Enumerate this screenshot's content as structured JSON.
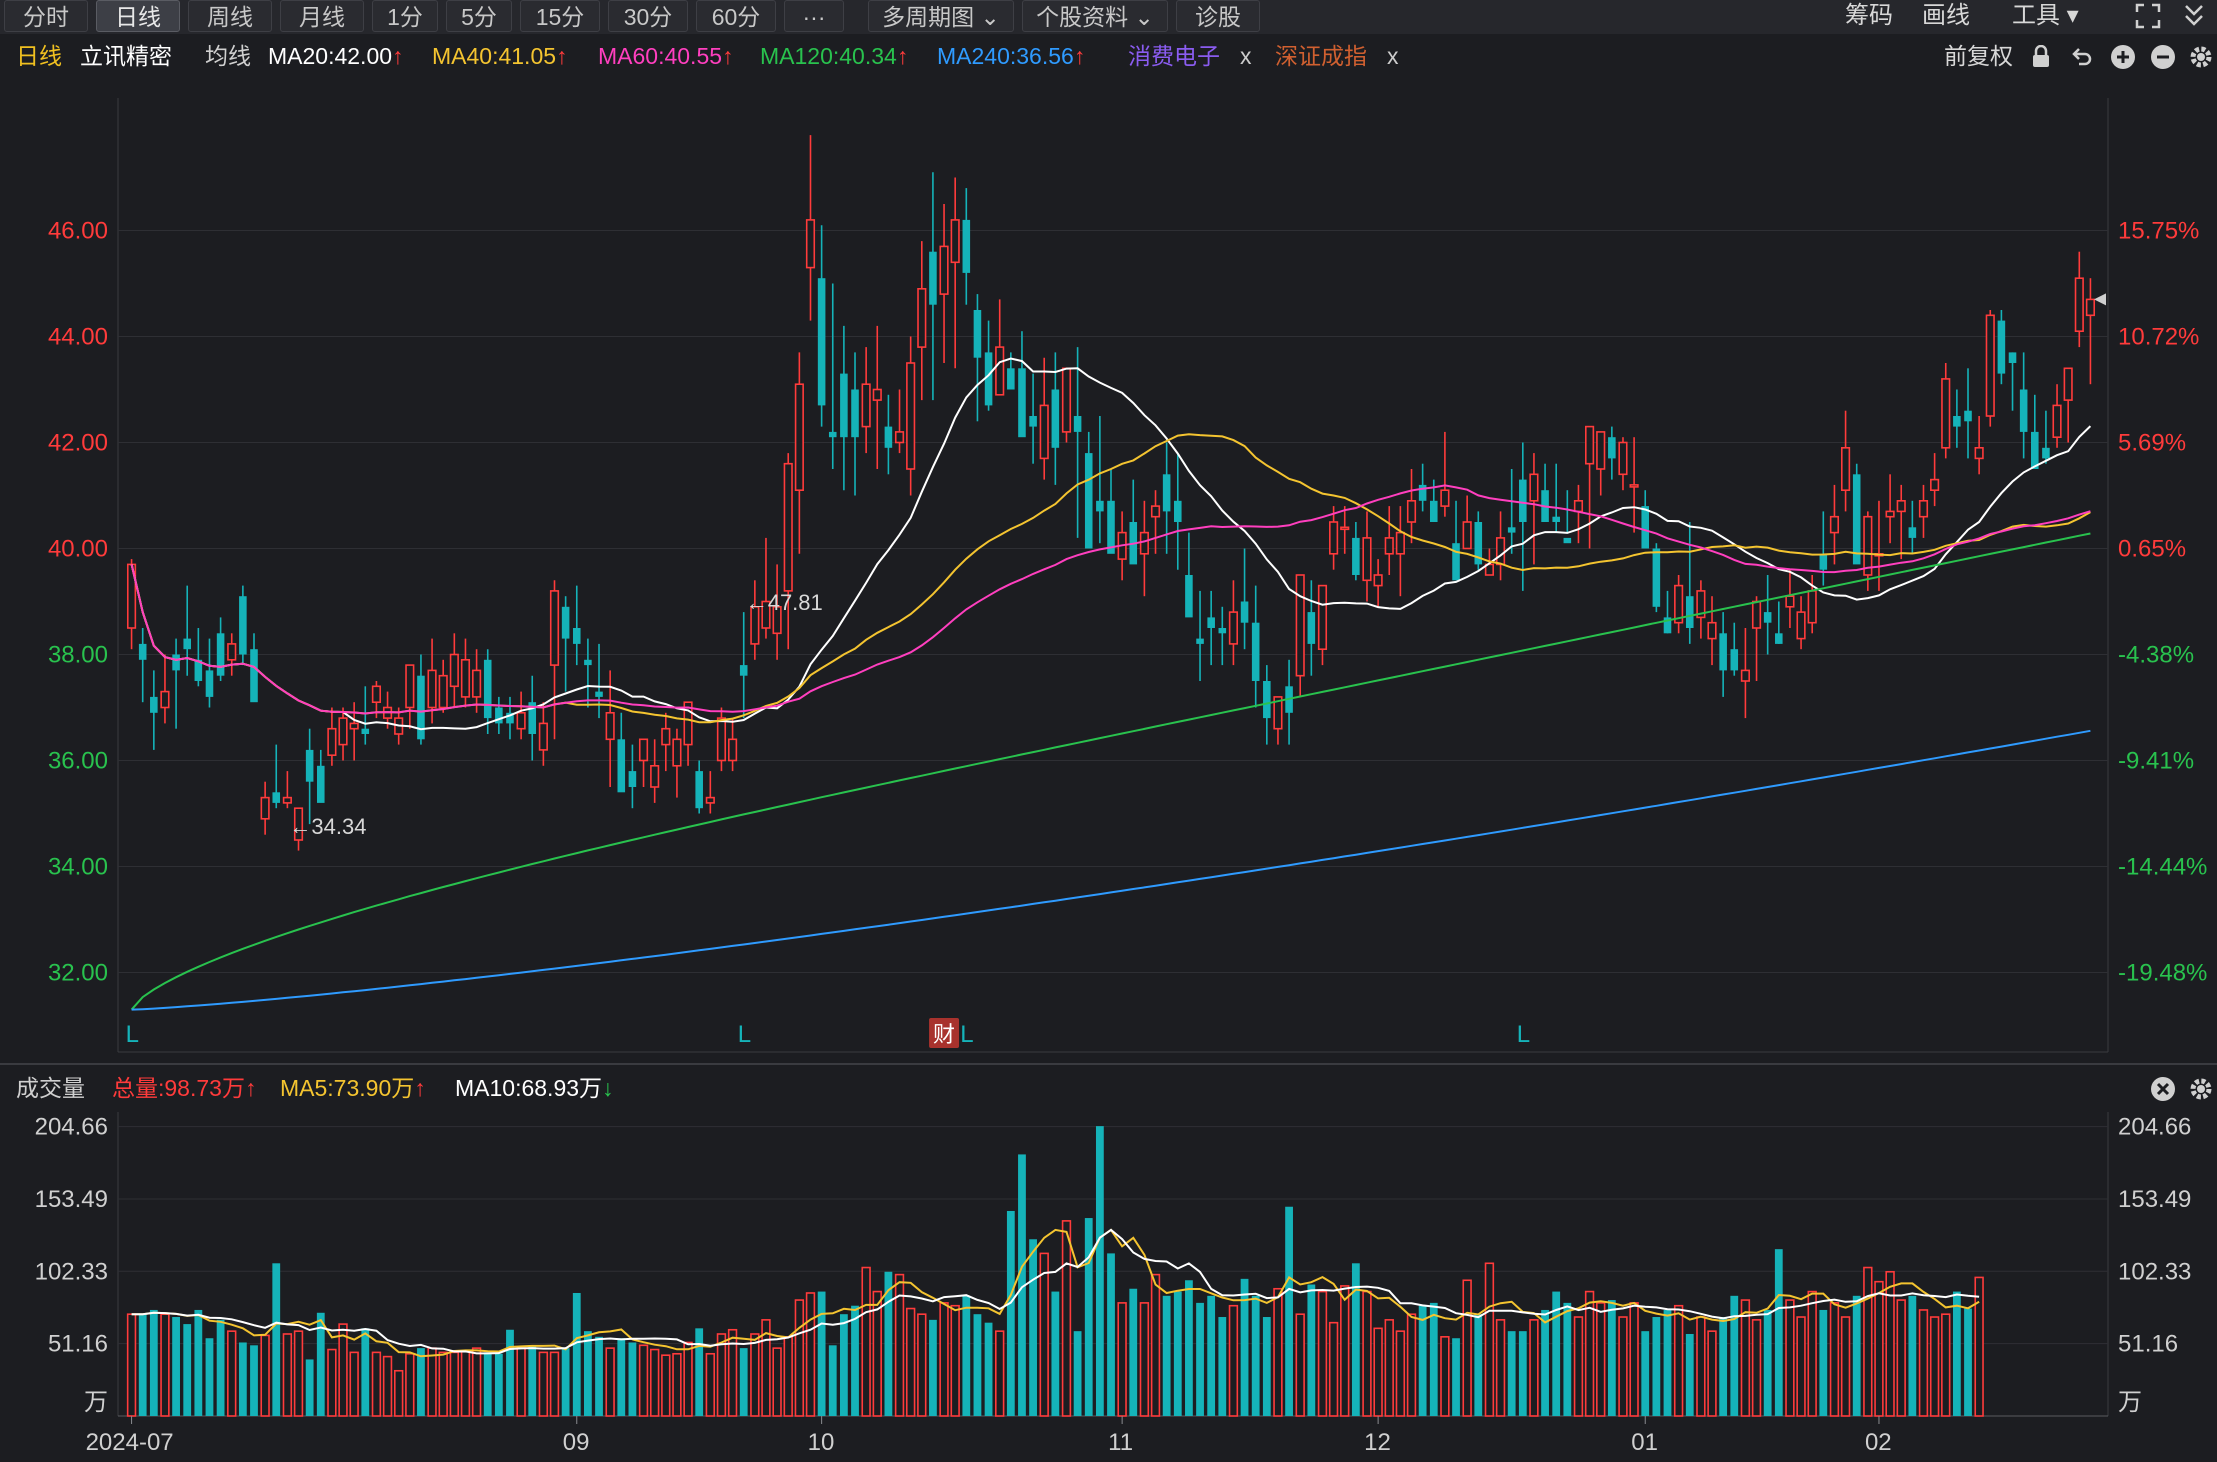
{
  "toolbar": {
    "tabs": [
      "分时",
      "日线",
      "周线",
      "月线",
      "1分",
      "5分",
      "15分",
      "30分",
      "60分",
      "···",
      "多周期图",
      "个股资料",
      "诊股"
    ],
    "active_tab": "日线",
    "right_items": [
      "筹码",
      "画线",
      "工具"
    ]
  },
  "info": {
    "period": "日线",
    "stock_name": "立讯精密",
    "ma_label": "均线",
    "ma": [
      {
        "text": "MA20:42.00",
        "arrow": "↑",
        "color": "#ffffff"
      },
      {
        "text": "MA40:41.05",
        "arrow": "↑",
        "color": "#f4c430"
      },
      {
        "text": "MA60:40.55",
        "arrow": "↑",
        "color": "#ff3fbf"
      },
      {
        "text": "MA120:40.34",
        "arrow": "↑",
        "color": "#29c24e"
      },
      {
        "text": "MA240:36.56",
        "arrow": "↑",
        "color": "#2f9bff"
      }
    ],
    "overlay1": "消费电子",
    "overlay2": "深证成指",
    "close_x": "x",
    "adjust": "前复权"
  },
  "volume_info": {
    "label": "成交量",
    "total": "总量:98.73万",
    "total_arrow": "↑",
    "ma5": "MA5:73.90万",
    "ma5_arrow": "↑",
    "ma10": "MA10:68.93万",
    "ma10_arrow": "↓"
  },
  "colors": {
    "up": "#ff3b3b",
    "down": "#15b3b9",
    "ma20": "#ffffff",
    "ma40": "#f4c430",
    "ma60": "#ff3fbf",
    "ma120": "#29c24e",
    "ma240": "#2f9bff"
  },
  "chart_data": {
    "type": "candlestick",
    "price_axis": {
      "ylim": [
        30.5,
        48.5
      ],
      "ticks": [
        "46.00",
        "44.00",
        "42.00",
        "40.00",
        "38.00",
        "36.00",
        "34.00",
        "32.00"
      ],
      "tick_values": [
        46,
        44,
        42,
        40,
        38,
        36,
        34,
        32
      ]
    },
    "pct_axis": {
      "ticks": [
        "15.75%",
        "10.72%",
        "5.69%",
        "0.65%",
        "-4.38%",
        "-9.41%",
        "-14.44%",
        "-19.48%"
      ]
    },
    "x_labels": [
      "2024-07",
      "09",
      "10",
      "11",
      "12",
      "01",
      "02"
    ],
    "x_label_index": [
      0,
      40,
      62,
      89,
      112,
      136,
      157
    ],
    "annotations": {
      "high": "←47.81",
      "high_index": 55,
      "low": "←34.34",
      "low_index": 14
    },
    "markers": {
      "L_indices": [
        0,
        55,
        75,
        125
      ],
      "L_text": "L",
      "cai_index": 73,
      "cai_text": "财"
    },
    "ohlc": [
      [
        38.5,
        39.8,
        38.1,
        39.7
      ],
      [
        38.2,
        38.5,
        37.1,
        37.9
      ],
      [
        37.2,
        37.7,
        36.2,
        36.9
      ],
      [
        37.0,
        38.0,
        36.7,
        37.3
      ],
      [
        38.0,
        38.3,
        36.6,
        37.7
      ],
      [
        38.3,
        39.3,
        37.6,
        38.1
      ],
      [
        37.9,
        38.5,
        37.4,
        37.5
      ],
      [
        37.7,
        38.3,
        37.0,
        37.2
      ],
      [
        38.4,
        38.7,
        37.5,
        37.6
      ],
      [
        37.9,
        38.4,
        37.6,
        38.2
      ],
      [
        39.1,
        39.3,
        37.8,
        38.0
      ],
      [
        38.1,
        38.4,
        37.9,
        37.1
      ],
      [
        34.9,
        35.6,
        34.6,
        35.3
      ],
      [
        35.4,
        36.3,
        35.1,
        35.2
      ],
      [
        35.2,
        35.8,
        35.1,
        35.3
      ],
      [
        34.5,
        35.1,
        34.3,
        35.1
      ],
      [
        36.2,
        36.6,
        34.8,
        35.6
      ],
      [
        35.9,
        36.2,
        35.3,
        35.2
      ],
      [
        36.1,
        37.0,
        35.9,
        36.6
      ],
      [
        36.3,
        37.0,
        36.0,
        36.8
      ],
      [
        36.6,
        37.1,
        36.0,
        36.7
      ],
      [
        36.6,
        37.4,
        36.3,
        36.5
      ],
      [
        37.1,
        37.5,
        36.8,
        37.4
      ],
      [
        36.8,
        37.3,
        36.6,
        37.0
      ],
      [
        36.5,
        37.0,
        36.3,
        36.8
      ],
      [
        37.0,
        37.8,
        36.6,
        37.8
      ],
      [
        37.6,
        38.0,
        36.3,
        36.4
      ],
      [
        37.0,
        38.3,
        36.7,
        37.7
      ],
      [
        37.0,
        37.9,
        36.9,
        37.6
      ],
      [
        37.4,
        38.4,
        37.0,
        38.0
      ],
      [
        37.2,
        38.3,
        37.0,
        37.9
      ],
      [
        37.2,
        38.1,
        36.9,
        37.7
      ],
      [
        37.9,
        38.1,
        36.5,
        36.8
      ],
      [
        37.0,
        37.2,
        36.5,
        36.7
      ],
      [
        36.9,
        37.2,
        36.4,
        36.7
      ],
      [
        36.6,
        37.3,
        36.4,
        36.9
      ],
      [
        37.1,
        37.6,
        36.0,
        36.5
      ],
      [
        36.2,
        37.1,
        35.9,
        36.7
      ],
      [
        37.8,
        39.4,
        36.4,
        39.2
      ],
      [
        38.9,
        39.1,
        37.3,
        38.3
      ],
      [
        38.5,
        39.3,
        37.8,
        38.2
      ],
      [
        37.9,
        38.3,
        37.0,
        37.8
      ],
      [
        37.3,
        38.2,
        36.8,
        37.2
      ],
      [
        36.4,
        37.7,
        35.5,
        36.9
      ],
      [
        36.4,
        36.9,
        35.6,
        35.4
      ],
      [
        35.8,
        36.3,
        35.1,
        35.5
      ],
      [
        36.0,
        36.3,
        35.5,
        36.4
      ],
      [
        35.5,
        36.4,
        35.2,
        35.9
      ],
      [
        36.3,
        36.9,
        35.8,
        36.6
      ],
      [
        35.9,
        36.6,
        35.3,
        36.4
      ],
      [
        36.3,
        36.9,
        35.9,
        37.1
      ],
      [
        35.8,
        36.0,
        35.0,
        35.1
      ],
      [
        35.2,
        35.8,
        35.0,
        35.3
      ],
      [
        36.0,
        37.0,
        35.8,
        36.8
      ],
      [
        36.0,
        36.8,
        35.8,
        36.4
      ],
      [
        37.8,
        38.8,
        36.8,
        37.6
      ],
      [
        38.2,
        39.4,
        37.9,
        38.9
      ],
      [
        38.5,
        40.2,
        38.3,
        39.0
      ],
      [
        38.4,
        39.7,
        37.9,
        38.9
      ],
      [
        39.2,
        41.8,
        38.1,
        41.6
      ],
      [
        41.1,
        43.7,
        39.9,
        43.1
      ],
      [
        45.3,
        47.8,
        44.3,
        46.2
      ],
      [
        45.1,
        46.1,
        42.3,
        42.7
      ],
      [
        42.2,
        45.0,
        41.5,
        42.1
      ],
      [
        43.3,
        44.2,
        41.1,
        42.1
      ],
      [
        43.0,
        43.7,
        41.0,
        42.1
      ],
      [
        42.3,
        43.8,
        41.8,
        43.1
      ],
      [
        42.8,
        44.2,
        41.5,
        43.0
      ],
      [
        42.3,
        42.9,
        41.4,
        41.9
      ],
      [
        42.0,
        43.0,
        41.8,
        42.2
      ],
      [
        41.5,
        44.0,
        41.0,
        43.5
      ],
      [
        43.8,
        45.8,
        42.8,
        44.9
      ],
      [
        45.6,
        47.1,
        42.8,
        44.6
      ],
      [
        44.8,
        46.5,
        43.5,
        45.7
      ],
      [
        45.4,
        47.0,
        43.4,
        46.2
      ],
      [
        46.2,
        46.8,
        44.6,
        45.2
      ],
      [
        44.5,
        44.8,
        42.4,
        43.6
      ],
      [
        43.7,
        44.3,
        42.6,
        42.7
      ],
      [
        42.9,
        44.7,
        42.9,
        43.8
      ],
      [
        43.4,
        43.7,
        43.0,
        43.0
      ],
      [
        43.4,
        44.1,
        42.3,
        42.1
      ],
      [
        42.5,
        43.3,
        41.6,
        42.3
      ],
      [
        41.7,
        43.6,
        41.3,
        42.7
      ],
      [
        43.0,
        43.7,
        41.2,
        41.9
      ],
      [
        42.2,
        43.1,
        42.0,
        43.4
      ],
      [
        42.5,
        43.8,
        40.2,
        42.2
      ],
      [
        41.8,
        42.2,
        41.5,
        40.0
      ],
      [
        40.9,
        42.5,
        40.1,
        40.7
      ],
      [
        40.9,
        41.5,
        40.4,
        39.9
      ],
      [
        39.8,
        40.7,
        39.4,
        40.3
      ],
      [
        40.5,
        41.3,
        39.8,
        39.7
      ],
      [
        39.9,
        40.9,
        39.1,
        40.3
      ],
      [
        40.6,
        41.1,
        39.9,
        40.8
      ],
      [
        41.4,
        42.0,
        39.9,
        40.7
      ],
      [
        40.9,
        41.8,
        39.6,
        40.5
      ],
      [
        39.5,
        40.3,
        38.8,
        38.7
      ],
      [
        38.3,
        39.2,
        37.5,
        38.2
      ],
      [
        38.7,
        39.2,
        37.8,
        38.5
      ],
      [
        38.5,
        38.9,
        37.8,
        38.4
      ],
      [
        38.2,
        39.4,
        37.8,
        38.8
      ],
      [
        39.0,
        40.0,
        38.1,
        38.6
      ],
      [
        38.6,
        39.3,
        37.0,
        37.5
      ],
      [
        37.5,
        37.8,
        36.3,
        36.8
      ],
      [
        36.6,
        37.1,
        36.3,
        37.2
      ],
      [
        37.4,
        37.9,
        36.3,
        36.9
      ],
      [
        37.6,
        39.4,
        37.2,
        39.5
      ],
      [
        38.8,
        39.4,
        37.6,
        38.2
      ],
      [
        38.1,
        39.2,
        37.8,
        39.3
      ],
      [
        39.9,
        40.8,
        39.6,
        40.5
      ],
      [
        40.4,
        40.8,
        39.9,
        40.4
      ],
      [
        40.2,
        40.5,
        39.4,
        39.5
      ],
      [
        39.4,
        40.7,
        39.0,
        40.2
      ],
      [
        39.3,
        39.8,
        38.9,
        39.5
      ],
      [
        39.9,
        40.8,
        39.5,
        40.2
      ],
      [
        39.9,
        40.8,
        39.1,
        40.3
      ],
      [
        40.5,
        41.5,
        40.1,
        40.9
      ],
      [
        41.2,
        41.6,
        40.7,
        40.9
      ],
      [
        40.9,
        41.3,
        40.5,
        40.5
      ],
      [
        40.8,
        42.2,
        40.6,
        41.1
      ],
      [
        40.1,
        40.9,
        39.6,
        39.4
      ],
      [
        40.0,
        41.0,
        40.2,
        40.5
      ],
      [
        40.5,
        40.7,
        39.6,
        39.7
      ],
      [
        39.5,
        40.0,
        39.5,
        39.7
      ],
      [
        39.7,
        40.7,
        39.4,
        40.2
      ],
      [
        40.4,
        41.5,
        39.9,
        40.3
      ],
      [
        41.3,
        42.0,
        39.2,
        40.5
      ],
      [
        40.9,
        41.8,
        39.7,
        41.4
      ],
      [
        41.1,
        41.6,
        40.7,
        40.5
      ],
      [
        40.6,
        41.6,
        40.3,
        40.5
      ],
      [
        40.2,
        41.1,
        40.3,
        40.1
      ],
      [
        40.7,
        41.2,
        40.1,
        40.9
      ],
      [
        41.6,
        42.3,
        40.0,
        42.3
      ],
      [
        41.5,
        42.1,
        41.0,
        42.2
      ],
      [
        42.1,
        42.3,
        41.3,
        41.7
      ],
      [
        41.4,
        42.1,
        41.1,
        42.0
      ],
      [
        41.2,
        42.1,
        40.3,
        41.2
      ],
      [
        40.8,
        41.1,
        40.1,
        40.0
      ],
      [
        40.0,
        40.1,
        38.8,
        38.9
      ],
      [
        38.7,
        39.2,
        38.4,
        38.4
      ],
      [
        38.6,
        39.5,
        38.4,
        39.3
      ],
      [
        39.1,
        40.5,
        38.2,
        38.5
      ],
      [
        38.7,
        39.4,
        38.3,
        39.2
      ],
      [
        38.3,
        39.1,
        37.8,
        38.6
      ],
      [
        38.4,
        38.8,
        37.2,
        37.7
      ],
      [
        38.1,
        38.6,
        37.6,
        37.7
      ],
      [
        37.5,
        38.5,
        36.8,
        37.7
      ],
      [
        38.5,
        39.1,
        37.5,
        39.0
      ],
      [
        38.8,
        39.5,
        38.0,
        38.6
      ],
      [
        38.4,
        39.0,
        38.2,
        38.2
      ],
      [
        38.9,
        39.6,
        38.5,
        39.1
      ],
      [
        38.3,
        39.1,
        38.1,
        38.8
      ],
      [
        38.6,
        39.5,
        38.4,
        39.2
      ],
      [
        39.9,
        40.7,
        39.3,
        39.6
      ],
      [
        40.3,
        41.2,
        39.7,
        40.6
      ],
      [
        41.1,
        42.6,
        40.7,
        41.9
      ],
      [
        41.4,
        41.6,
        39.8,
        39.7
      ],
      [
        39.5,
        40.7,
        39.2,
        40.6
      ],
      [
        39.9,
        40.9,
        39.2,
        39.9
      ],
      [
        40.6,
        41.4,
        40.1,
        40.7
      ],
      [
        40.7,
        41.2,
        39.8,
        40.9
      ],
      [
        40.4,
        40.9,
        39.9,
        40.2
      ],
      [
        40.6,
        41.2,
        40.2,
        40.9
      ],
      [
        41.1,
        41.8,
        40.8,
        41.3
      ],
      [
        41.9,
        43.5,
        41.7,
        43.2
      ],
      [
        42.5,
        43.0,
        41.9,
        42.3
      ],
      [
        42.6,
        43.4,
        41.7,
        42.4
      ],
      [
        41.7,
        42.5,
        41.4,
        41.9
      ],
      [
        42.5,
        44.5,
        42.3,
        44.4
      ],
      [
        44.3,
        44.5,
        43.1,
        43.3
      ],
      [
        43.7,
        43.7,
        42.6,
        43.5
      ],
      [
        43.0,
        43.7,
        41.7,
        42.2
      ],
      [
        42.2,
        42.9,
        41.8,
        41.5
      ],
      [
        41.9,
        42.6,
        41.6,
        41.7
      ],
      [
        42.1,
        43.1,
        41.9,
        42.7
      ],
      [
        42.8,
        43.2,
        42.0,
        43.4
      ],
      [
        44.1,
        45.6,
        43.8,
        45.1
      ],
      [
        44.4,
        45.1,
        43.1,
        44.7
      ]
    ],
    "volume_axis": {
      "ylim": [
        0,
        215
      ],
      "ticks": [
        "204.66",
        "153.49",
        "102.33",
        "51.16"
      ],
      "tick_values": [
        204.66,
        153.49,
        102.33,
        51.16
      ],
      "unit": "万"
    },
    "volume": [
      72,
      72,
      75,
      72,
      70,
      65,
      75,
      55,
      68,
      60,
      52,
      50,
      57,
      108,
      58,
      60,
      40,
      73,
      47,
      65,
      45,
      62,
      45,
      42,
      32,
      44,
      48,
      48,
      45,
      45,
      46,
      48,
      45,
      44,
      61,
      48,
      50,
      45,
      45,
      48,
      87,
      60,
      56,
      48,
      55,
      52,
      50,
      47,
      43,
      44,
      52,
      62,
      44,
      58,
      61,
      48,
      58,
      68,
      48,
      56,
      82,
      87,
      88,
      50,
      72,
      78,
      105,
      88,
      102,
      100,
      76,
      72,
      68,
      80,
      78,
      85,
      72,
      66,
      60,
      145,
      185,
      125,
      115,
      88,
      138,
      60,
      140,
      205,
      115,
      80,
      90,
      80,
      100,
      85,
      88,
      96,
      80,
      85,
      70,
      78,
      97,
      85,
      70,
      90,
      148,
      72,
      93,
      88,
      66,
      92,
      108,
      88,
      62,
      68,
      60,
      72,
      78,
      80,
      56,
      55,
      96,
      72,
      108,
      68,
      60,
      60,
      68,
      75,
      88,
      80,
      70,
      88,
      80,
      82,
      70,
      80,
      60,
      70,
      75,
      78,
      58,
      70,
      60,
      70,
      85,
      82,
      68,
      75,
      118,
      82,
      70,
      88,
      75,
      80,
      70,
      85,
      105,
      95,
      102,
      82,
      85,
      75,
      70,
      72,
      88,
      76,
      98
    ]
  }
}
